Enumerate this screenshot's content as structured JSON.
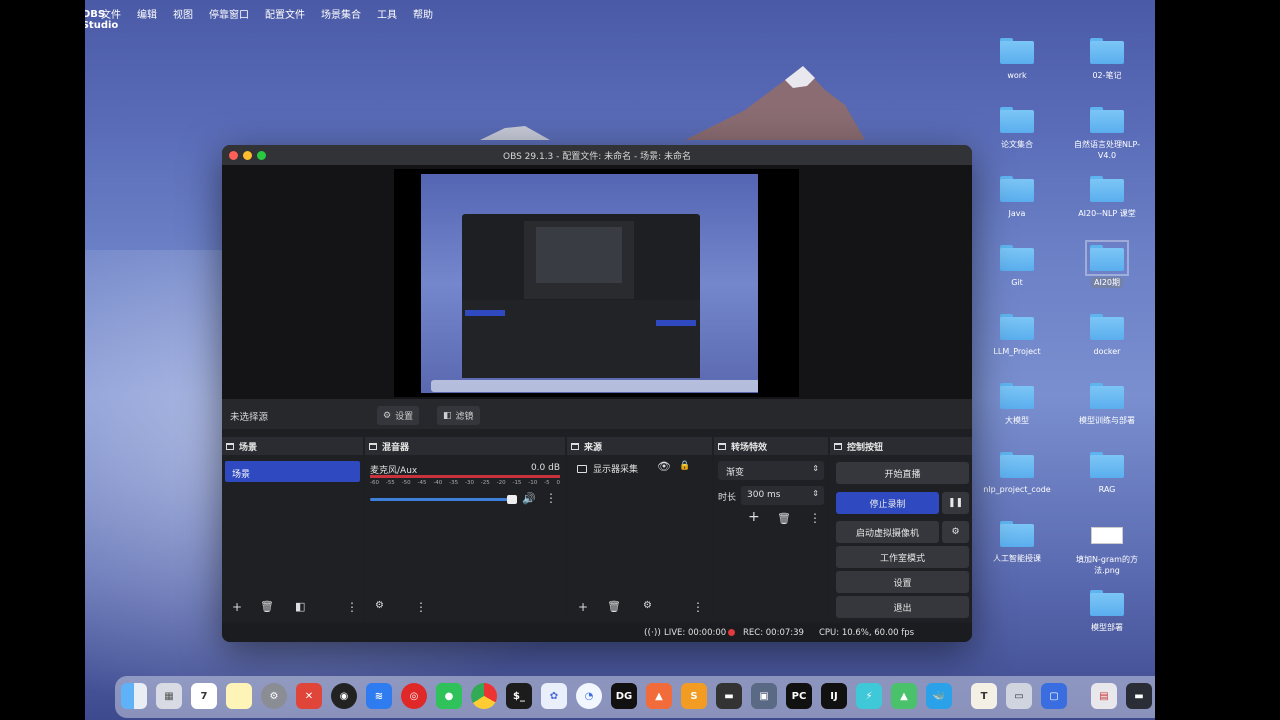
{
  "menubar": {
    "app_name": "OBS Studio",
    "items": [
      "文件",
      "编辑",
      "视图",
      "停靠窗口",
      "配置文件",
      "场景集合",
      "工具",
      "帮助"
    ]
  },
  "desktop": {
    "icons": [
      {
        "label": "work"
      },
      {
        "label": "02-笔记"
      },
      {
        "label": "论文集合"
      },
      {
        "label": "自然语言处理NLP-V4.0"
      },
      {
        "label": "Java"
      },
      {
        "label": "AI20--NLP 课堂"
      },
      {
        "label": "Git"
      },
      {
        "label": "AI20期"
      },
      {
        "label": "LLM_Project"
      },
      {
        "label": "docker"
      },
      {
        "label": "大模型"
      },
      {
        "label": "模型训练与部署"
      },
      {
        "label": "nlp_project_code"
      },
      {
        "label": "RAG"
      },
      {
        "label": "人工智能授课"
      },
      {
        "label": "填加N-gram的方法.png"
      },
      {
        "label": "模型部署"
      }
    ]
  },
  "window": {
    "title": "OBS 29.1.3 - 配置文件: 未命名 - 场景: 未命名"
  },
  "source_toolbar": {
    "no_source": "未选择源",
    "settings": "设置",
    "filters": "滤镜"
  },
  "scenes": {
    "title": "场景",
    "items": [
      "场景"
    ]
  },
  "mixer": {
    "title": "混音器",
    "channel": "麦克风/Aux",
    "level": "0.0 dB",
    "ticks": [
      "-60",
      "-55",
      "-50",
      "-45",
      "-40",
      "-35",
      "-30",
      "-25",
      "-20",
      "-15",
      "-10",
      "-5",
      "0"
    ]
  },
  "sources": {
    "title": "来源",
    "items": [
      "显示器采集"
    ]
  },
  "transitions": {
    "title": "转场特效",
    "type": "渐变",
    "duration_label": "时长",
    "duration": "300 ms"
  },
  "controls": {
    "title": "控制按钮",
    "start_stream": "开始直播",
    "stop_record": "停止录制",
    "virtual_cam": "启动虚拟摄像机",
    "studio_mode": "工作室模式",
    "settings": "设置",
    "exit": "退出"
  },
  "status": {
    "live": "LIVE: 00:00:00",
    "rec": "REC: 00:07:39",
    "cpu": "CPU: 10.6%, 60.00 fps"
  },
  "dock": {
    "calendar_day": "7",
    "apps": [
      "finder-icon",
      "launchpad-icon",
      "calendar-icon",
      "notes-icon",
      "system-settings-icon",
      "xmind-icon",
      "obs-icon",
      "lark-icon",
      "netease-music-icon",
      "wechat-icon",
      "chrome-icon",
      "terminal-icon",
      "app-icon",
      "app-icon",
      "datagrip-icon",
      "app-icon",
      "sublime-icon",
      "app-icon",
      "app-icon",
      "pycharm-icon",
      "intellij-icon",
      "app-icon",
      "app-icon",
      "docker-icon",
      "textedit-icon",
      "app-icon",
      "app-icon",
      "app-icon",
      "app-icon",
      "trash-icon"
    ]
  },
  "colors": {
    "accent": "#2f4ac0",
    "window_bg": "#1e1f22",
    "rec_red": "#e0393e",
    "meter_red": "#c8323c"
  }
}
